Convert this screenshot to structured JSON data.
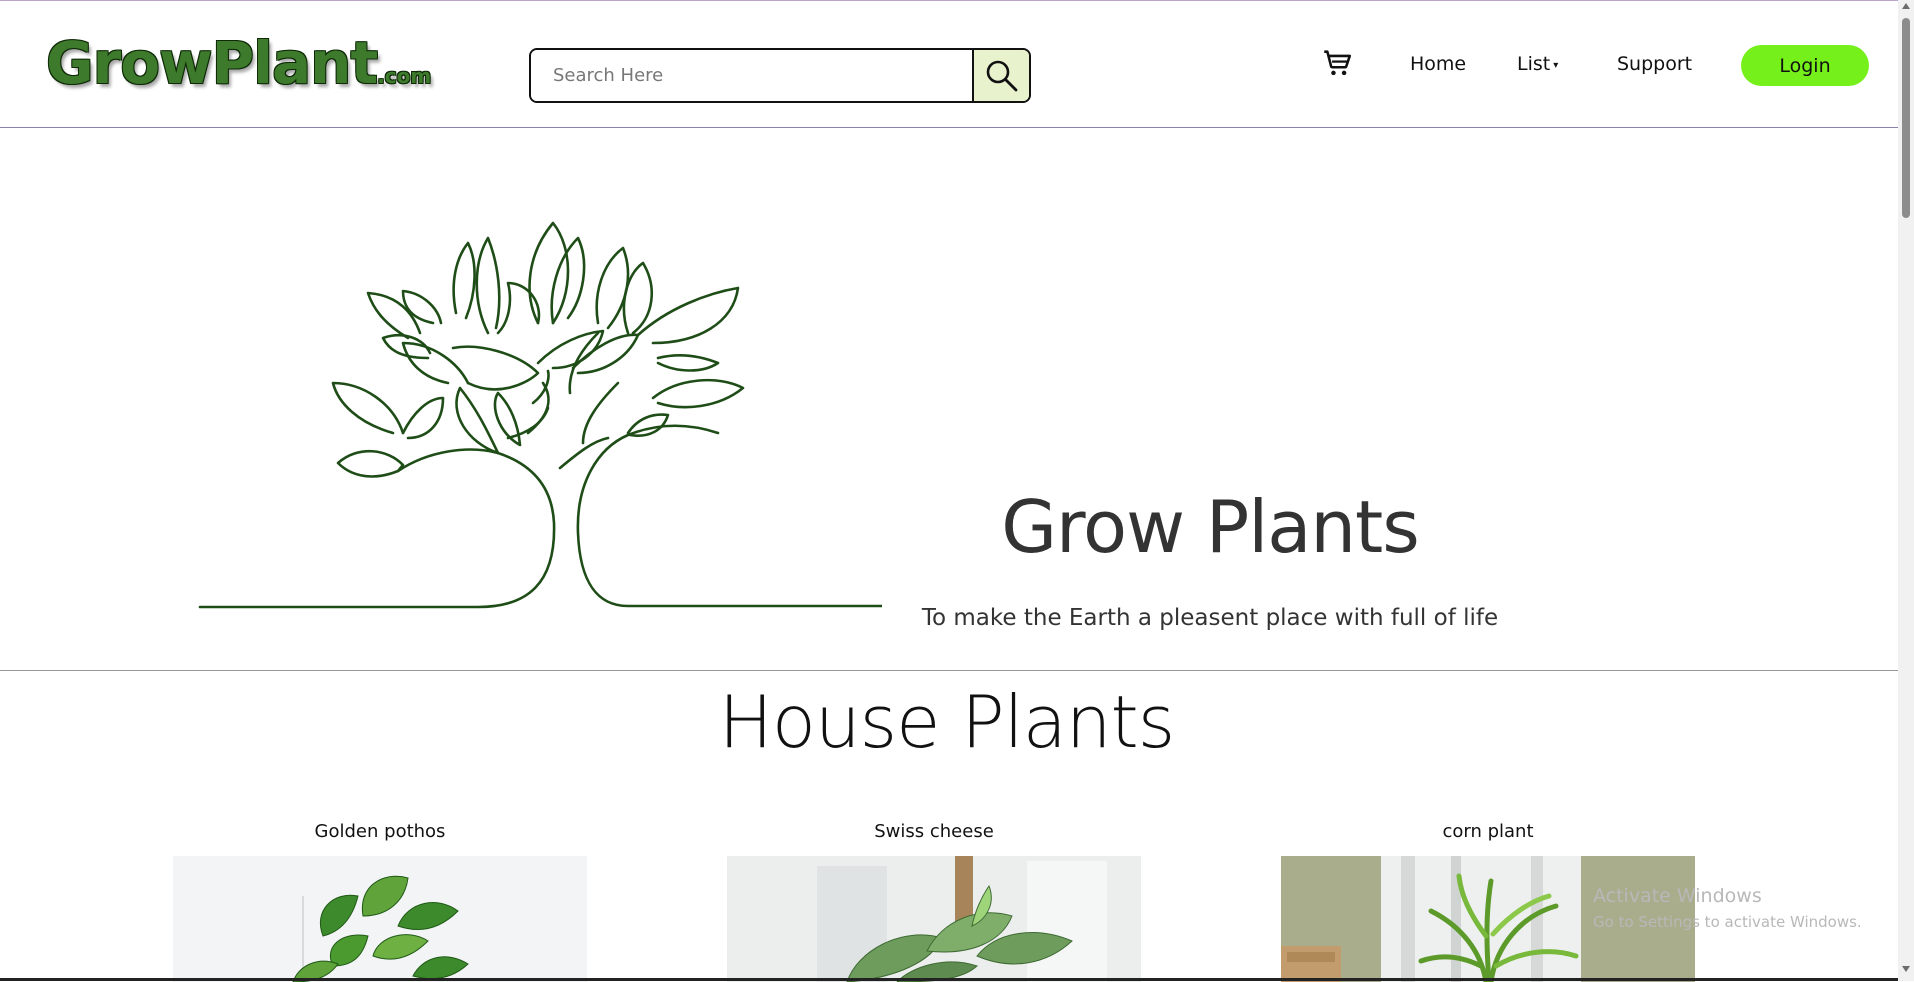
{
  "header": {
    "logo_main": "GrowPlant",
    "logo_suffix": ".com",
    "search_placeholder": "Search Here",
    "search_icon": "magnifier-icon",
    "cart_icon": "shopping-cart-icon",
    "nav": {
      "home": "Home",
      "list": "List",
      "list_caret": "▾",
      "support": "Support"
    },
    "login_label": "Login",
    "login_color": "#76f01a"
  },
  "hero": {
    "image": "line-art-tree",
    "title": "Grow Plants",
    "subtitle": "To make the Earth a pleasent place with full of life"
  },
  "section": {
    "title": "House Plants",
    "plants": [
      {
        "name": "Golden pothos"
      },
      {
        "name": "Swiss cheese"
      },
      {
        "name": "corn plant"
      }
    ]
  },
  "watermark": {
    "line1": "Activate Windows",
    "line2": "Go to Settings to activate Windows."
  },
  "colors": {
    "brand_green": "#3d7a2b",
    "tree_stroke": "#1f4d17",
    "search_button_bg": "#e8f3cd"
  }
}
